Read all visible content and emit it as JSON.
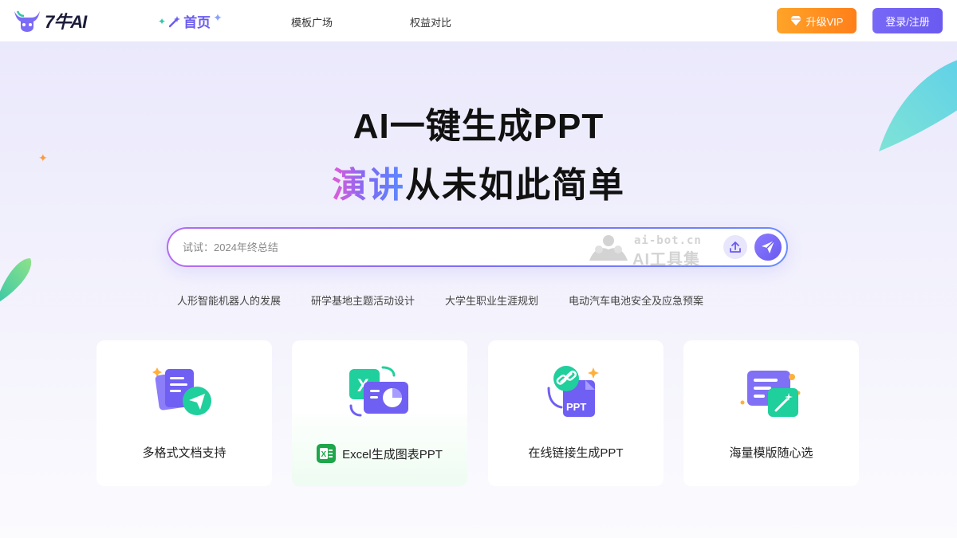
{
  "header": {
    "logo_text": "7牛AI",
    "nav": {
      "home": "首页",
      "templates": "模板广场",
      "compare": "权益对比"
    },
    "vip_label": "升级VIP",
    "login_label": "登录/注册"
  },
  "hero": {
    "title": "AI一键生成PPT",
    "subtitle_highlight": "演讲",
    "subtitle_rest": "从未如此简单"
  },
  "search": {
    "placeholder": "试试：2024年终总结",
    "watermark_url": "ai-bot.cn",
    "watermark_name": "AI工具集"
  },
  "suggestions": [
    "人形智能机器人的发展",
    "研学基地主题活动设计",
    "大学生职业生涯规划",
    "电动汽车电池安全及应急预案"
  ],
  "cards": [
    {
      "label": "多格式文档支持",
      "icon": "documents-send-icon"
    },
    {
      "label": "Excel生成图表PPT",
      "icon": "excel-chart-icon"
    },
    {
      "label": "在线链接生成PPT",
      "icon": "link-ppt-icon"
    },
    {
      "label": "海量模版随心选",
      "icon": "template-magic-icon"
    }
  ],
  "colors": {
    "accent": "#6a5af0",
    "vip_orange": "#ff8a1f",
    "excel_green": "#1ea64a",
    "teal": "#2fd0b0"
  }
}
